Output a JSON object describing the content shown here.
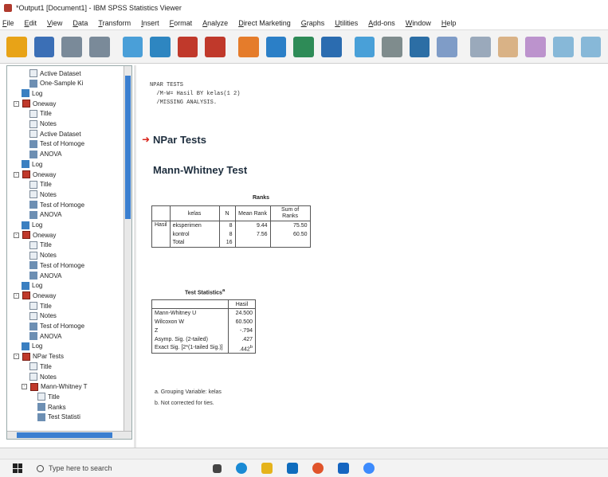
{
  "window": {
    "title": "*Output1 [Document1] - IBM SPSS Statistics Viewer"
  },
  "menu": [
    "File",
    "Edit",
    "View",
    "Data",
    "Transform",
    "Insert",
    "Format",
    "Analyze",
    "Direct Marketing",
    "Graphs",
    "Utilities",
    "Add-ons",
    "Window",
    "Help"
  ],
  "toolbar_icons": [
    "open-folder-icon",
    "save-icon",
    "print-icon",
    "print-preview-icon",
    "export-icon",
    "recall-dialog-icon",
    "undo-icon",
    "redo-icon",
    "goto-data-icon",
    "goto-case-icon",
    "goto-variable-icon",
    "variables-icon",
    "show-all-icon",
    "hide-icon",
    "designate-window-icon",
    "insert-heading-icon",
    "insert-title-icon",
    "insert-text-icon",
    "create-chart-icon",
    "promote-icon",
    "demote-icon"
  ],
  "outline": {
    "rows": [
      {
        "depth": 3,
        "icon": "page",
        "label": "Active Dataset"
      },
      {
        "depth": 3,
        "icon": "tbl",
        "label": "One-Sample Ki"
      },
      {
        "depth": 2,
        "icon": "log",
        "label": "Log"
      },
      {
        "depth": 1,
        "icon": "book",
        "label": "Oneway",
        "exp": "-"
      },
      {
        "depth": 3,
        "icon": "page",
        "label": "Title"
      },
      {
        "depth": 3,
        "icon": "page",
        "label": "Notes"
      },
      {
        "depth": 3,
        "icon": "page",
        "label": "Active Dataset"
      },
      {
        "depth": 3,
        "icon": "tbl",
        "label": "Test of Homoge"
      },
      {
        "depth": 3,
        "icon": "tbl",
        "label": "ANOVA"
      },
      {
        "depth": 2,
        "icon": "log",
        "label": "Log"
      },
      {
        "depth": 1,
        "icon": "book",
        "label": "Oneway",
        "exp": "-"
      },
      {
        "depth": 3,
        "icon": "page",
        "label": "Title"
      },
      {
        "depth": 3,
        "icon": "page",
        "label": "Notes"
      },
      {
        "depth": 3,
        "icon": "tbl",
        "label": "Test of Homoge"
      },
      {
        "depth": 3,
        "icon": "tbl",
        "label": "ANOVA"
      },
      {
        "depth": 2,
        "icon": "log",
        "label": "Log"
      },
      {
        "depth": 1,
        "icon": "book",
        "label": "Oneway",
        "exp": "-"
      },
      {
        "depth": 3,
        "icon": "page",
        "label": "Title"
      },
      {
        "depth": 3,
        "icon": "page",
        "label": "Notes"
      },
      {
        "depth": 3,
        "icon": "tbl",
        "label": "Test of Homoge"
      },
      {
        "depth": 3,
        "icon": "tbl",
        "label": "ANOVA"
      },
      {
        "depth": 2,
        "icon": "log",
        "label": "Log"
      },
      {
        "depth": 1,
        "icon": "book",
        "label": "Oneway",
        "exp": "-"
      },
      {
        "depth": 3,
        "icon": "page",
        "label": "Title"
      },
      {
        "depth": 3,
        "icon": "page",
        "label": "Notes"
      },
      {
        "depth": 3,
        "icon": "tbl",
        "label": "Test of Homoge"
      },
      {
        "depth": 3,
        "icon": "tbl",
        "label": "ANOVA"
      },
      {
        "depth": 2,
        "icon": "log",
        "label": "Log"
      },
      {
        "depth": 1,
        "icon": "book",
        "label": "NPar Tests",
        "exp": "-"
      },
      {
        "depth": 3,
        "icon": "page",
        "label": "Title"
      },
      {
        "depth": 3,
        "icon": "page",
        "label": "Notes"
      },
      {
        "depth": 2,
        "icon": "book",
        "label": "Mann-Whitney T",
        "exp": "-"
      },
      {
        "depth": 4,
        "icon": "page",
        "label": "Title"
      },
      {
        "depth": 4,
        "icon": "tbl",
        "label": "Ranks"
      },
      {
        "depth": 4,
        "icon": "tbl",
        "label": "Test Statisti"
      }
    ]
  },
  "output": {
    "syntax": [
      "NPAR TESTS",
      "  /M-W= Hasil BY kelas(1 2)",
      "  /MISSING ANALYSIS."
    ],
    "section_title": "NPar Tests",
    "procedure_title": "Mann-Whitney Test",
    "ranks": {
      "caption": "Ranks",
      "headers": [
        "",
        "kelas",
        "N",
        "Mean Rank",
        "Sum of Ranks"
      ],
      "var": "Hasil",
      "rows": [
        [
          "eksperimen",
          "8",
          "9.44",
          "75.50"
        ],
        [
          "kontrol",
          "8",
          "7.56",
          "60.50"
        ],
        [
          "Total",
          "16",
          "",
          ""
        ]
      ]
    },
    "stats": {
      "caption": "Test Statistics",
      "caption_sup": "a",
      "header": "Hasil",
      "rows": [
        [
          "Mann-Whitney U",
          "24.500"
        ],
        [
          "Wilcoxon W",
          "60.500"
        ],
        [
          "Z",
          "-.794"
        ],
        [
          "Asymp. Sig. (2-tailed)",
          ".427"
        ],
        [
          "Exact Sig. [2*(1-tailed Sig.)]",
          ".442"
        ]
      ],
      "last_sup": "b",
      "footnotes": [
        "a. Grouping Variable: kelas",
        "b. Not corrected for ties."
      ]
    }
  },
  "taskbar": {
    "search_placeholder": "Type here to search"
  }
}
